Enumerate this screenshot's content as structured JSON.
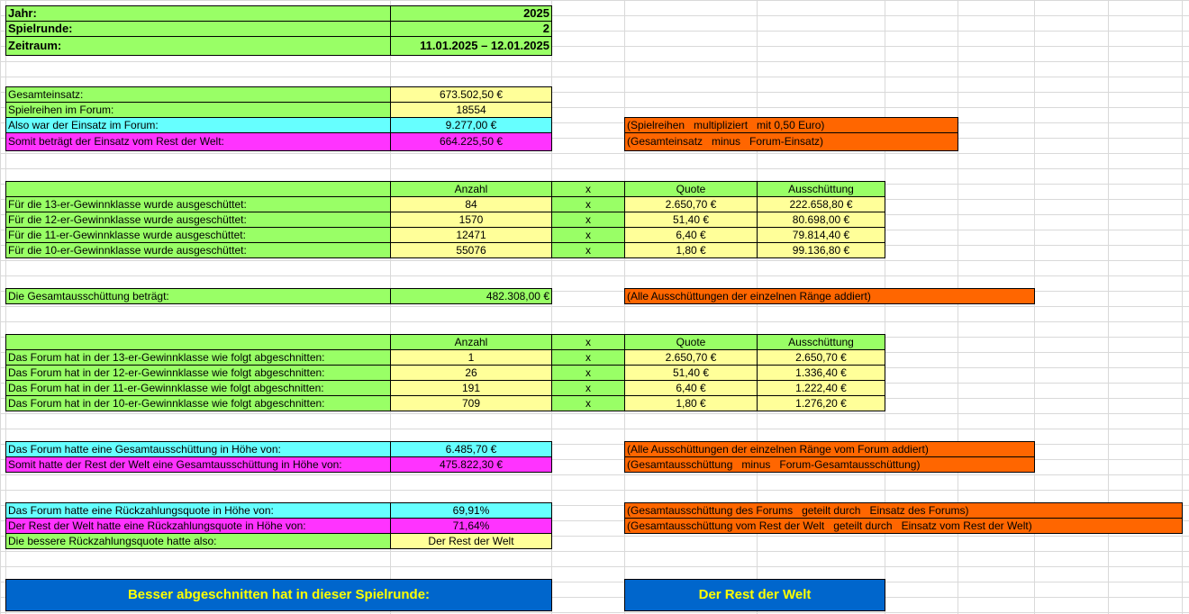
{
  "header": {
    "jahr_label": "Jahr:",
    "jahr_value": "2025",
    "runde_label": "Spielrunde:",
    "runde_value": "2",
    "zeitraum_label": "Zeitraum:",
    "zeitraum_value": "11.01.2025 – 12.01.2025"
  },
  "einsatz": {
    "gesamt_label": "Gesamteinsatz:",
    "gesamt_value": "673.502,50 €",
    "reihen_label": "Spielreihen im Forum:",
    "reihen_value": "18554",
    "forum_label": "Also war der Einsatz im Forum:",
    "forum_value": "9.277,00 €",
    "forum_note": "(Spielreihen   multipliziert   mit 0,50 Euro)",
    "rest_label": "Somit beträgt der Einsatz vom Rest der Welt:",
    "rest_value": "664.225,50 €",
    "rest_note": "(Gesamteinsatz   minus   Forum-Einsatz)"
  },
  "columns": {
    "anzahl": "Anzahl",
    "x": "x",
    "quote": "Quote",
    "ausschuettung": "Ausschüttung"
  },
  "gesamt_rows": [
    {
      "label": "Für die 13-er-Gewinnklasse wurde ausgeschüttet:",
      "anzahl": "84",
      "x": "x",
      "quote": "2.650,70 €",
      "aus": "222.658,80 €"
    },
    {
      "label": "Für die 12-er-Gewinnklasse wurde ausgeschüttet:",
      "anzahl": "1570",
      "x": "x",
      "quote": "51,40 €",
      "aus": "80.698,00 €"
    },
    {
      "label": "Für die 11-er-Gewinnklasse wurde ausgeschüttet:",
      "anzahl": "12471",
      "x": "x",
      "quote": "6,40 €",
      "aus": "79.814,40 €"
    },
    {
      "label": "Für die 10-er-Gewinnklasse wurde ausgeschüttet:",
      "anzahl": "55076",
      "x": "x",
      "quote": "1,80 €",
      "aus": "99.136,80 €"
    }
  ],
  "gesamtaus": {
    "label": "Die Gesamtausschüttung beträgt:",
    "value": "482.308,00 €",
    "note": "(Alle Ausschüttungen der einzelnen Ränge addiert)"
  },
  "forum_rows": [
    {
      "label": "Das Forum hat in der 13-er-Gewinnklasse wie folgt abgeschnitten:",
      "anzahl": "1",
      "x": "x",
      "quote": "2.650,70 €",
      "aus": "2.650,70 €"
    },
    {
      "label": "Das Forum hat in der 12-er-Gewinnklasse wie folgt abgeschnitten:",
      "anzahl": "26",
      "x": "x",
      "quote": "51,40 €",
      "aus": "1.336,40 €"
    },
    {
      "label": "Das Forum hat in der 11-er-Gewinnklasse wie folgt abgeschnitten:",
      "anzahl": "191",
      "x": "x",
      "quote": "6,40 €",
      "aus": "1.222,40 €"
    },
    {
      "label": "Das Forum hat in der 10-er-Gewinnklasse wie folgt abgeschnitten:",
      "anzahl": "709",
      "x": "x",
      "quote": "1,80 €",
      "aus": "1.276,20 €"
    }
  ],
  "vergleich": {
    "forum_aus_label": "Das Forum hatte eine Gesamtausschüttung in Höhe von:",
    "forum_aus_value": "6.485,70 €",
    "forum_aus_note": "(Alle Ausschüttungen der einzelnen Ränge vom Forum addiert)",
    "rest_aus_label": "Somit hatte der Rest der Welt eine Gesamtausschüttung in Höhe von:",
    "rest_aus_value": "475.822,30 €",
    "rest_aus_note": "(Gesamtausschüttung   minus   Forum-Gesamtausschüttung)",
    "forum_quote_label": "Das Forum hatte eine Rückzahlungsquote in Höhe von:",
    "forum_quote_value": "69,91%",
    "forum_quote_note": "(Gesamtausschüttung des Forums   geteilt durch   Einsatz des Forums)",
    "rest_quote_label": "Der Rest der Welt hatte eine Rückzahlungsquote in Höhe von:",
    "rest_quote_value": "71,64%",
    "rest_quote_note": "(Gesamtausschüttung vom Rest der Welt   geteilt durch   Einsatz vom Rest der Welt)",
    "besser_label": "Die bessere Rückzahlungsquote hatte also:",
    "besser_value": "Der Rest der Welt"
  },
  "result": {
    "label": "Besser abgeschnitten hat in dieser Spielrunde:",
    "value": "Der Rest der Welt"
  },
  "colors": {
    "green": "#99ff66",
    "yellow": "#ffff99",
    "cyan": "#66ffff",
    "magenta": "#ff33ff",
    "orange": "#ff6600",
    "blue": "#0066cc",
    "result_text": "#ffff00"
  }
}
